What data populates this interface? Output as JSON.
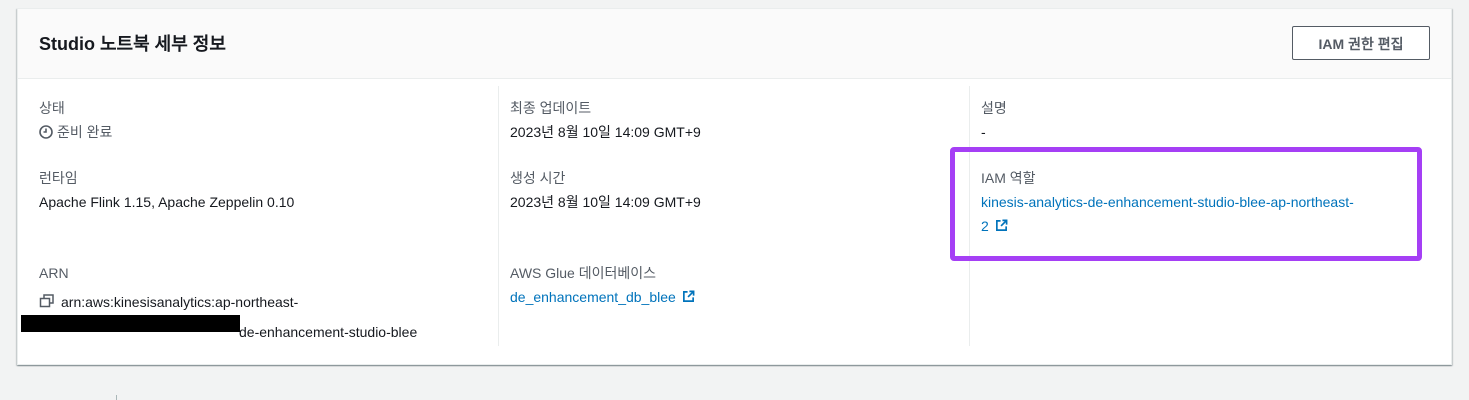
{
  "panel": {
    "title": "Studio 노트북 세부 정보",
    "edit_button_label": "IAM 권한 편집"
  },
  "col1": {
    "status_label": "상태",
    "status_value": "준비 완료",
    "status_icon": "clock-icon",
    "runtime_label": "런타임",
    "runtime_value": "Apache Flink 1.15, Apache Zeppelin 0.10",
    "arn_label": "ARN",
    "arn_line1": "arn:aws:kinesisanalytics:ap-northeast-",
    "arn_line2_visible": "de-enhancement-studio-blee",
    "arn_icon": "copy-icon"
  },
  "col2": {
    "updated_label": "최종 업데이트",
    "updated_value": "2023년 8월 10일 14:09 GMT+9",
    "created_label": "생성 시간",
    "created_value": "2023년 8월 10일 14:09 GMT+9",
    "glue_label": "AWS Glue 데이터베이스",
    "glue_link": "de_enhancement_db_blee",
    "glue_icon": "external-link-icon"
  },
  "col3": {
    "description_label": "설명",
    "description_value": "-",
    "iam_role_label": "IAM 역할",
    "iam_role_link_line1": "kinesis-analytics-de-enhancement-studio-blee-ap-northeast-",
    "iam_role_link_line2": "2",
    "iam_icon": "external-link-icon"
  },
  "colors": {
    "link": "#0073bb",
    "highlight": "#a53ff5"
  }
}
